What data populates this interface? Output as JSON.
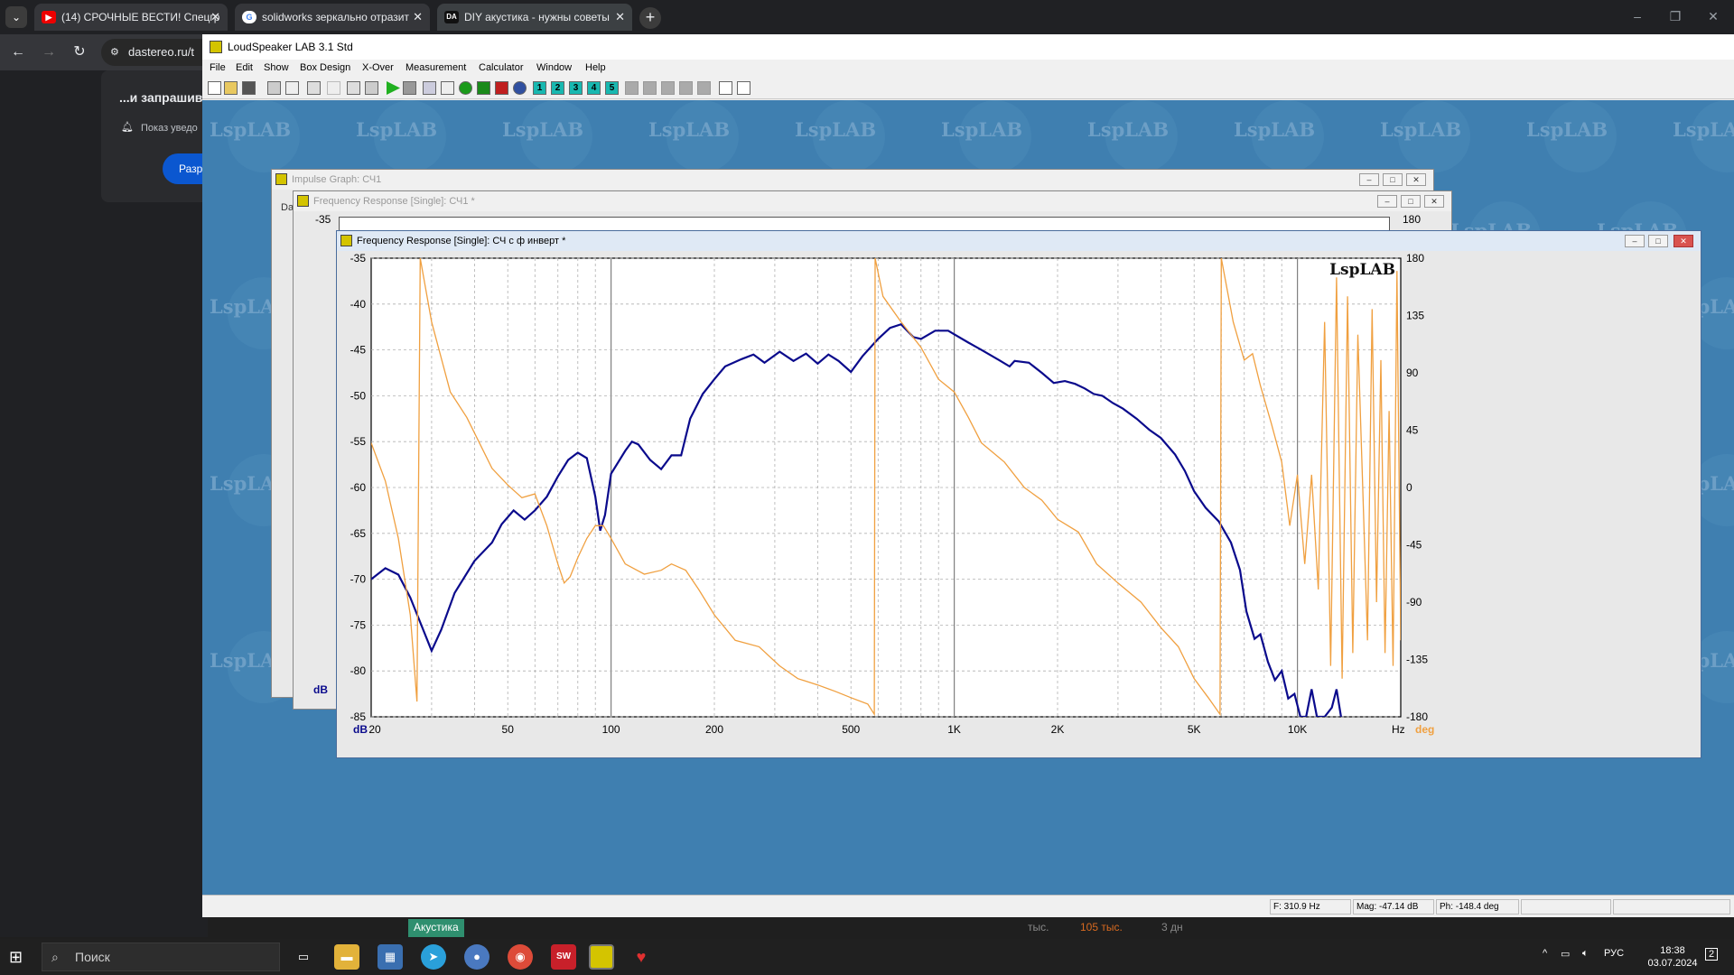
{
  "browser": {
    "tabs": [
      {
        "label": "(14) СРОЧНЫЕ ВЕСТИ! Спецгр",
        "icon": "youtube-icon"
      },
      {
        "label": "solidworks зеркально отразит",
        "icon": "google-icon"
      },
      {
        "label": "DIY акустика - нужны советы",
        "icon": "dastereo-icon"
      }
    ],
    "url": "dastereo.ru/t",
    "notification": {
      "question": "...и запрашив",
      "text": "Показ уведо",
      "button": "Разр"
    }
  },
  "app": {
    "title": "LoudSpeaker LAB 3.1 Std",
    "menu": [
      "File",
      "Edit",
      "Show",
      "Box Design",
      "X-Over",
      "Measurement",
      "Calculator",
      "Window",
      "Help"
    ],
    "toolbar_numbers": [
      "1",
      "2",
      "3",
      "4",
      "5"
    ],
    "watermark": "LspLAB",
    "windows": {
      "impulse_title": "Impulse Graph: СЧ1",
      "impulse_side_label": "Da",
      "fr_single_title": "Frequency Response [Single]: СЧ1 *",
      "fr_single_top_left": "-35",
      "fr_single_top_right": "180",
      "fr_single_dB": "dB",
      "fr_active_title": "Frequency Response [Single]: СЧ с ф инверт *"
    },
    "status": {
      "freq": "F: 310.9 Hz",
      "mag": "Mag: -47.14 dB",
      "phase": "Ph: -148.4 deg"
    }
  },
  "chart_data": {
    "type": "line",
    "title": "",
    "watermark": "LspLAB",
    "xlabel": "Hz",
    "ylabel": "dB",
    "y2label": "deg",
    "x_scale": "log",
    "xlim": [
      20,
      20000
    ],
    "ylim": [
      -85,
      -35
    ],
    "y2lim": [
      -180,
      180
    ],
    "x_ticks": [
      20,
      50,
      100,
      200,
      500,
      1000,
      2000,
      5000,
      10000
    ],
    "x_tick_labels": [
      "20",
      "50",
      "100",
      "200",
      "500",
      "1K",
      "2K",
      "5K",
      "10K"
    ],
    "y_ticks": [
      "-35",
      "-40",
      "-45",
      "-50",
      "-55",
      "-60",
      "-65",
      "-70",
      "-75",
      "-80",
      "-85"
    ],
    "y2_ticks": [
      "180",
      "135",
      "90",
      "45",
      "0",
      "-45",
      "-90",
      "-135",
      "-180"
    ],
    "grid": true,
    "series": [
      {
        "role": "magnitude",
        "color": "#0a0a8c",
        "points": [
          [
            20,
            -70
          ],
          [
            22,
            -68.8
          ],
          [
            24,
            -69.5
          ],
          [
            26,
            -72
          ],
          [
            28,
            -75
          ],
          [
            30,
            -77.8
          ],
          [
            32,
            -75.5
          ],
          [
            35,
            -71.5
          ],
          [
            40,
            -68
          ],
          [
            45,
            -66
          ],
          [
            48,
            -64
          ],
          [
            52,
            -62.5
          ],
          [
            56,
            -63.5
          ],
          [
            60,
            -62.5
          ],
          [
            65,
            -61
          ],
          [
            70,
            -58.8
          ],
          [
            75,
            -57
          ],
          [
            80,
            -56.2
          ],
          [
            85,
            -56.8
          ],
          [
            90,
            -61
          ],
          [
            93,
            -64.7
          ],
          [
            96,
            -63
          ],
          [
            100,
            -58.5
          ],
          [
            110,
            -56
          ],
          [
            115,
            -55
          ],
          [
            120,
            -55.3
          ],
          [
            130,
            -57
          ],
          [
            140,
            -58
          ],
          [
            150,
            -56.5
          ],
          [
            160,
            -56.5
          ],
          [
            170,
            -52.5
          ],
          [
            185,
            -49.8
          ],
          [
            200,
            -48.2
          ],
          [
            215,
            -46.8
          ],
          [
            240,
            -46
          ],
          [
            260,
            -45.5
          ],
          [
            280,
            -46.4
          ],
          [
            310,
            -45.2
          ],
          [
            340,
            -46.2
          ],
          [
            370,
            -45.4
          ],
          [
            400,
            -46.5
          ],
          [
            430,
            -45.5
          ],
          [
            460,
            -46.2
          ],
          [
            500,
            -47.4
          ],
          [
            540,
            -45.7
          ],
          [
            600,
            -43.8
          ],
          [
            650,
            -42.6
          ],
          [
            700,
            -42.2
          ],
          [
            760,
            -43.6
          ],
          [
            800,
            -43.8
          ],
          [
            880,
            -42.9
          ],
          [
            960,
            -42.9
          ],
          [
            1000,
            -43.3
          ],
          [
            1100,
            -44.2
          ],
          [
            1200,
            -45
          ],
          [
            1350,
            -46.1
          ],
          [
            1450,
            -46.8
          ],
          [
            1500,
            -46.2
          ],
          [
            1650,
            -46.4
          ],
          [
            1800,
            -47.5
          ],
          [
            1950,
            -48.6
          ],
          [
            2100,
            -48.4
          ],
          [
            2250,
            -48.7
          ],
          [
            2400,
            -49.2
          ],
          [
            2550,
            -49.8
          ],
          [
            2700,
            -50
          ],
          [
            2900,
            -50.8
          ],
          [
            3100,
            -51.4
          ],
          [
            3400,
            -52.5
          ],
          [
            3700,
            -53.7
          ],
          [
            4000,
            -54.6
          ],
          [
            4400,
            -56.4
          ],
          [
            4700,
            -58.2
          ],
          [
            5000,
            -60.4
          ],
          [
            5400,
            -62.2
          ],
          [
            5900,
            -63.7
          ],
          [
            6400,
            -66
          ],
          [
            6800,
            -69
          ],
          [
            7100,
            -73.5
          ],
          [
            7500,
            -76.5
          ],
          [
            7800,
            -76
          ],
          [
            8200,
            -79
          ],
          [
            8600,
            -81
          ],
          [
            9000,
            -80
          ],
          [
            9400,
            -83
          ],
          [
            9800,
            -82.5
          ],
          [
            10200,
            -85
          ],
          [
            10600,
            -85
          ],
          [
            11000,
            -82
          ],
          [
            11400,
            -85
          ],
          [
            12000,
            -85
          ],
          [
            12600,
            -84
          ],
          [
            13000,
            -82
          ],
          [
            13400,
            -85
          ]
        ]
      },
      {
        "role": "phase",
        "color": "#f0a040",
        "points": [
          [
            20,
            35
          ],
          [
            22,
            5
          ],
          [
            24,
            -40
          ],
          [
            26,
            -100
          ],
          [
            27.2,
            -168
          ],
          [
            27.8,
            180
          ],
          [
            30,
            130
          ],
          [
            34,
            75
          ],
          [
            38,
            55
          ],
          [
            45,
            15
          ],
          [
            50,
            2
          ],
          [
            55,
            -8
          ],
          [
            60,
            -5
          ],
          [
            65,
            -30
          ],
          [
            70,
            -60
          ],
          [
            73,
            -75
          ],
          [
            76,
            -70
          ],
          [
            80,
            -55
          ],
          [
            85,
            -40
          ],
          [
            90,
            -30
          ],
          [
            95,
            -30
          ],
          [
            100,
            -40
          ],
          [
            110,
            -60
          ],
          [
            125,
            -68
          ],
          [
            140,
            -65
          ],
          [
            150,
            -60
          ],
          [
            165,
            -65
          ],
          [
            180,
            -80
          ],
          [
            200,
            -100
          ],
          [
            230,
            -120
          ],
          [
            270,
            -125
          ],
          [
            310,
            -140
          ],
          [
            350,
            -150
          ],
          [
            400,
            -155
          ],
          [
            450,
            -160
          ],
          [
            500,
            -165
          ],
          [
            560,
            -170
          ],
          [
            585,
            -178
          ],
          [
            588,
            180
          ],
          [
            620,
            150
          ],
          [
            700,
            130
          ],
          [
            800,
            110
          ],
          [
            900,
            85
          ],
          [
            1000,
            75
          ],
          [
            1100,
            55
          ],
          [
            1200,
            35
          ],
          [
            1400,
            20
          ],
          [
            1600,
            0
          ],
          [
            1800,
            -10
          ],
          [
            2000,
            -25
          ],
          [
            2300,
            -35
          ],
          [
            2600,
            -60
          ],
          [
            3000,
            -75
          ],
          [
            3500,
            -90
          ],
          [
            4000,
            -110
          ],
          [
            4500,
            -125
          ],
          [
            5000,
            -150
          ],
          [
            5500,
            -165
          ],
          [
            5950,
            -178
          ],
          [
            6000,
            180
          ],
          [
            6500,
            130
          ],
          [
            7000,
            100
          ],
          [
            7400,
            105
          ],
          [
            7800,
            80
          ],
          [
            8400,
            50
          ],
          [
            9000,
            20
          ],
          [
            9500,
            -30
          ],
          [
            10000,
            10
          ],
          [
            10500,
            -60
          ],
          [
            11000,
            10
          ],
          [
            11500,
            -80
          ],
          [
            12000,
            130
          ],
          [
            12500,
            -140
          ],
          [
            13000,
            165
          ],
          [
            13500,
            -150
          ],
          [
            14000,
            150
          ],
          [
            14500,
            -130
          ],
          [
            15000,
            120
          ],
          [
            15500,
            0
          ],
          [
            16000,
            -120
          ],
          [
            16500,
            140
          ],
          [
            17000,
            -90
          ],
          [
            17500,
            100
          ],
          [
            18000,
            -130
          ],
          [
            18500,
            60
          ],
          [
            19000,
            -140
          ],
          [
            19500,
            170
          ],
          [
            20000,
            -120
          ]
        ]
      }
    ]
  },
  "taskbar": {
    "search": "Поиск",
    "tag": "Акустика",
    "tray_lang": "РУС",
    "time": "18:38",
    "date": "03.07.2024",
    "notify_count": "2",
    "bg_texts": [
      "тыс.",
      "105 тыс.",
      "3 дн"
    ]
  }
}
